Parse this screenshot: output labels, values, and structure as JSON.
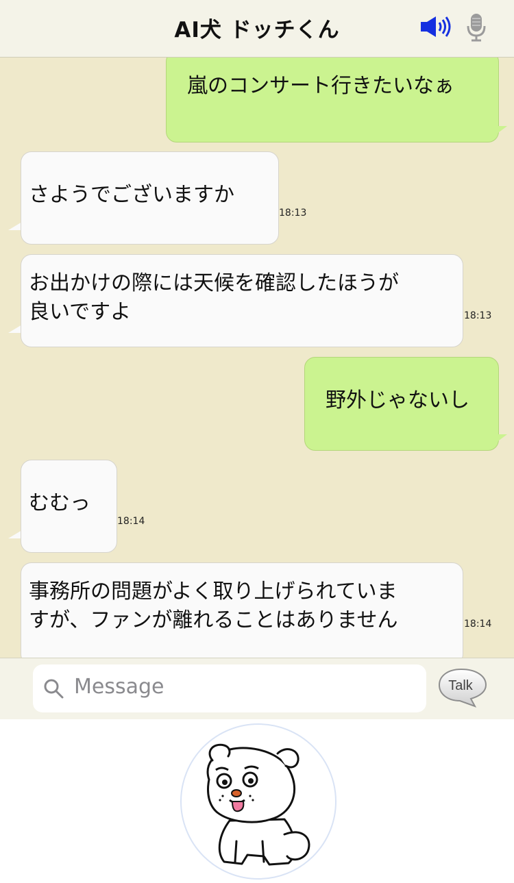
{
  "header": {
    "title": "AI犬 ドッチくん",
    "speaker_icon": "speaker-icon",
    "mic_icon": "microphone-icon"
  },
  "messages": [
    {
      "side": "out",
      "text": "嵐のコンサート行きたいなぁ",
      "time": ""
    },
    {
      "side": "in",
      "text": "さようでございますか",
      "time": "18:13"
    },
    {
      "side": "in",
      "text": "お出かけの際には天候を確認したほうが\n良いですよ",
      "time": "18:13"
    },
    {
      "side": "out",
      "text": "野外じゃないし",
      "time": ""
    },
    {
      "side": "in",
      "text": "むむっ",
      "time": "18:14"
    },
    {
      "side": "in",
      "text": "事務所の問題がよく取り上げられていま\nすが、ファンが離れることはありません",
      "time": "18:14"
    }
  ],
  "input": {
    "placeholder": "Message",
    "talk_label": "Talk"
  },
  "colors": {
    "header_bg": "#f4f3e8",
    "chat_bg": "#efe9cb",
    "outgoing_bubble": "#cbf390",
    "incoming_bubble": "#fafafa",
    "speaker_blue": "#1530e0"
  },
  "mascot": {
    "icon": "dog-mascot-icon"
  }
}
